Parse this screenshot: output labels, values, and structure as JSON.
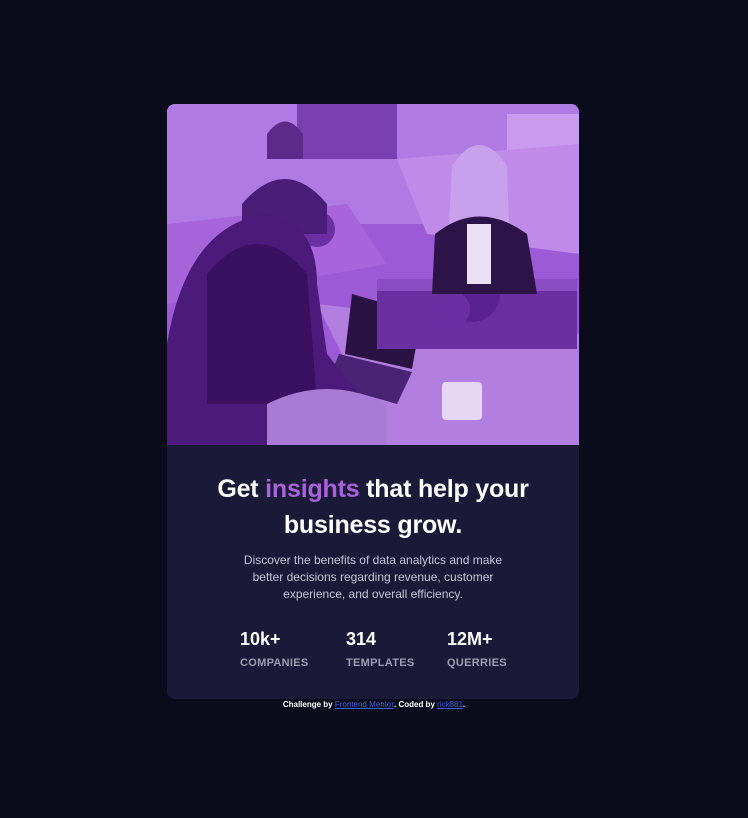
{
  "card": {
    "hero_image": {
      "description_icon": "office-team-photo",
      "tint": "#9c5bd6"
    },
    "headline": {
      "before": "Get ",
      "accent": "insights",
      "after": " that help your business grow."
    },
    "description": "Discover the benefits of data analytics and make better decisions regarding revenue, customer experience, and overall efficiency.",
    "stats": [
      {
        "value": "10k+",
        "label": "COMPANIES"
      },
      {
        "value": "314",
        "label": "TEMPLATES"
      },
      {
        "value": "12M+",
        "label": "QUERRIES"
      }
    ]
  },
  "attribution": {
    "prefix": "Challenge by ",
    "link1": "Frontend Mentor",
    "middle": ". Coded by ",
    "link2": "rick881",
    "suffix": "."
  },
  "colors": {
    "page_bg": "#0a0c1c",
    "card_bg": "#1b1938",
    "accent": "#a962d9",
    "link": "#3f5fdd"
  }
}
